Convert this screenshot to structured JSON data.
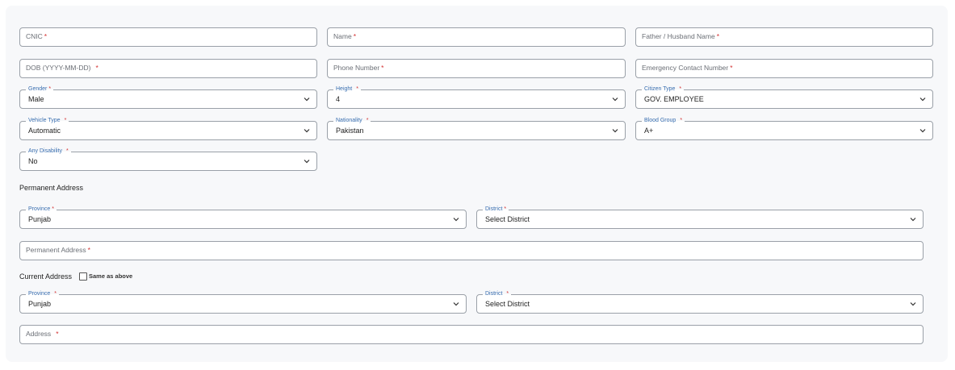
{
  "fields": {
    "cnic": {
      "placeholder": "CNIC",
      "req": "*"
    },
    "name": {
      "placeholder": "Name",
      "req": "*"
    },
    "father_husband_name": {
      "placeholder": "Father / Husband Name",
      "req": "*"
    },
    "dob": {
      "placeholder": "DOB (YYYY-MM-DD)",
      "req": "*"
    },
    "phone_number": {
      "placeholder": "Phone Number",
      "req": "*"
    },
    "emergency_contact": {
      "placeholder": "Emergency Contact Number",
      "req": "*"
    },
    "permanent_address": {
      "placeholder": "Permanent Address",
      "req": "*"
    },
    "address": {
      "placeholder": "Address",
      "req": "*"
    }
  },
  "selects": {
    "gender": {
      "label": "Gender",
      "req": "*",
      "value": "Male"
    },
    "height": {
      "label": "Height",
      "req": "*",
      "value": "4"
    },
    "citizen_type": {
      "label": "Citizen Type",
      "req": "*",
      "value": "GOV. EMPLOYEE"
    },
    "vehicle_type": {
      "label": "Vehicle Type",
      "req": "*",
      "value": "Automatic"
    },
    "nationality": {
      "label": "Nationality",
      "req": "*",
      "value": "Pakistan"
    },
    "blood_group": {
      "label": "Blood Group",
      "req": "*",
      "value": "A+"
    },
    "any_disability": {
      "label": "Any Disability",
      "req": "*",
      "value": "No"
    },
    "perm_province": {
      "label": "Province",
      "req": "*",
      "value": "Punjab"
    },
    "perm_district": {
      "label": "District",
      "req": "*",
      "value": "Select District"
    },
    "curr_province": {
      "label": "Province",
      "req": "*",
      "value": "Punjab"
    },
    "curr_district": {
      "label": "District",
      "req": "*",
      "value": "Select District"
    }
  },
  "sections": {
    "permanent_address": "Permanent Address",
    "current_address": "Current Address",
    "same_as_above": "Same as above"
  },
  "colors": {
    "border": "#9aa0a8",
    "required": "#d32f2f",
    "label": "#3a6fb0",
    "panel": "#f7f8fa"
  }
}
